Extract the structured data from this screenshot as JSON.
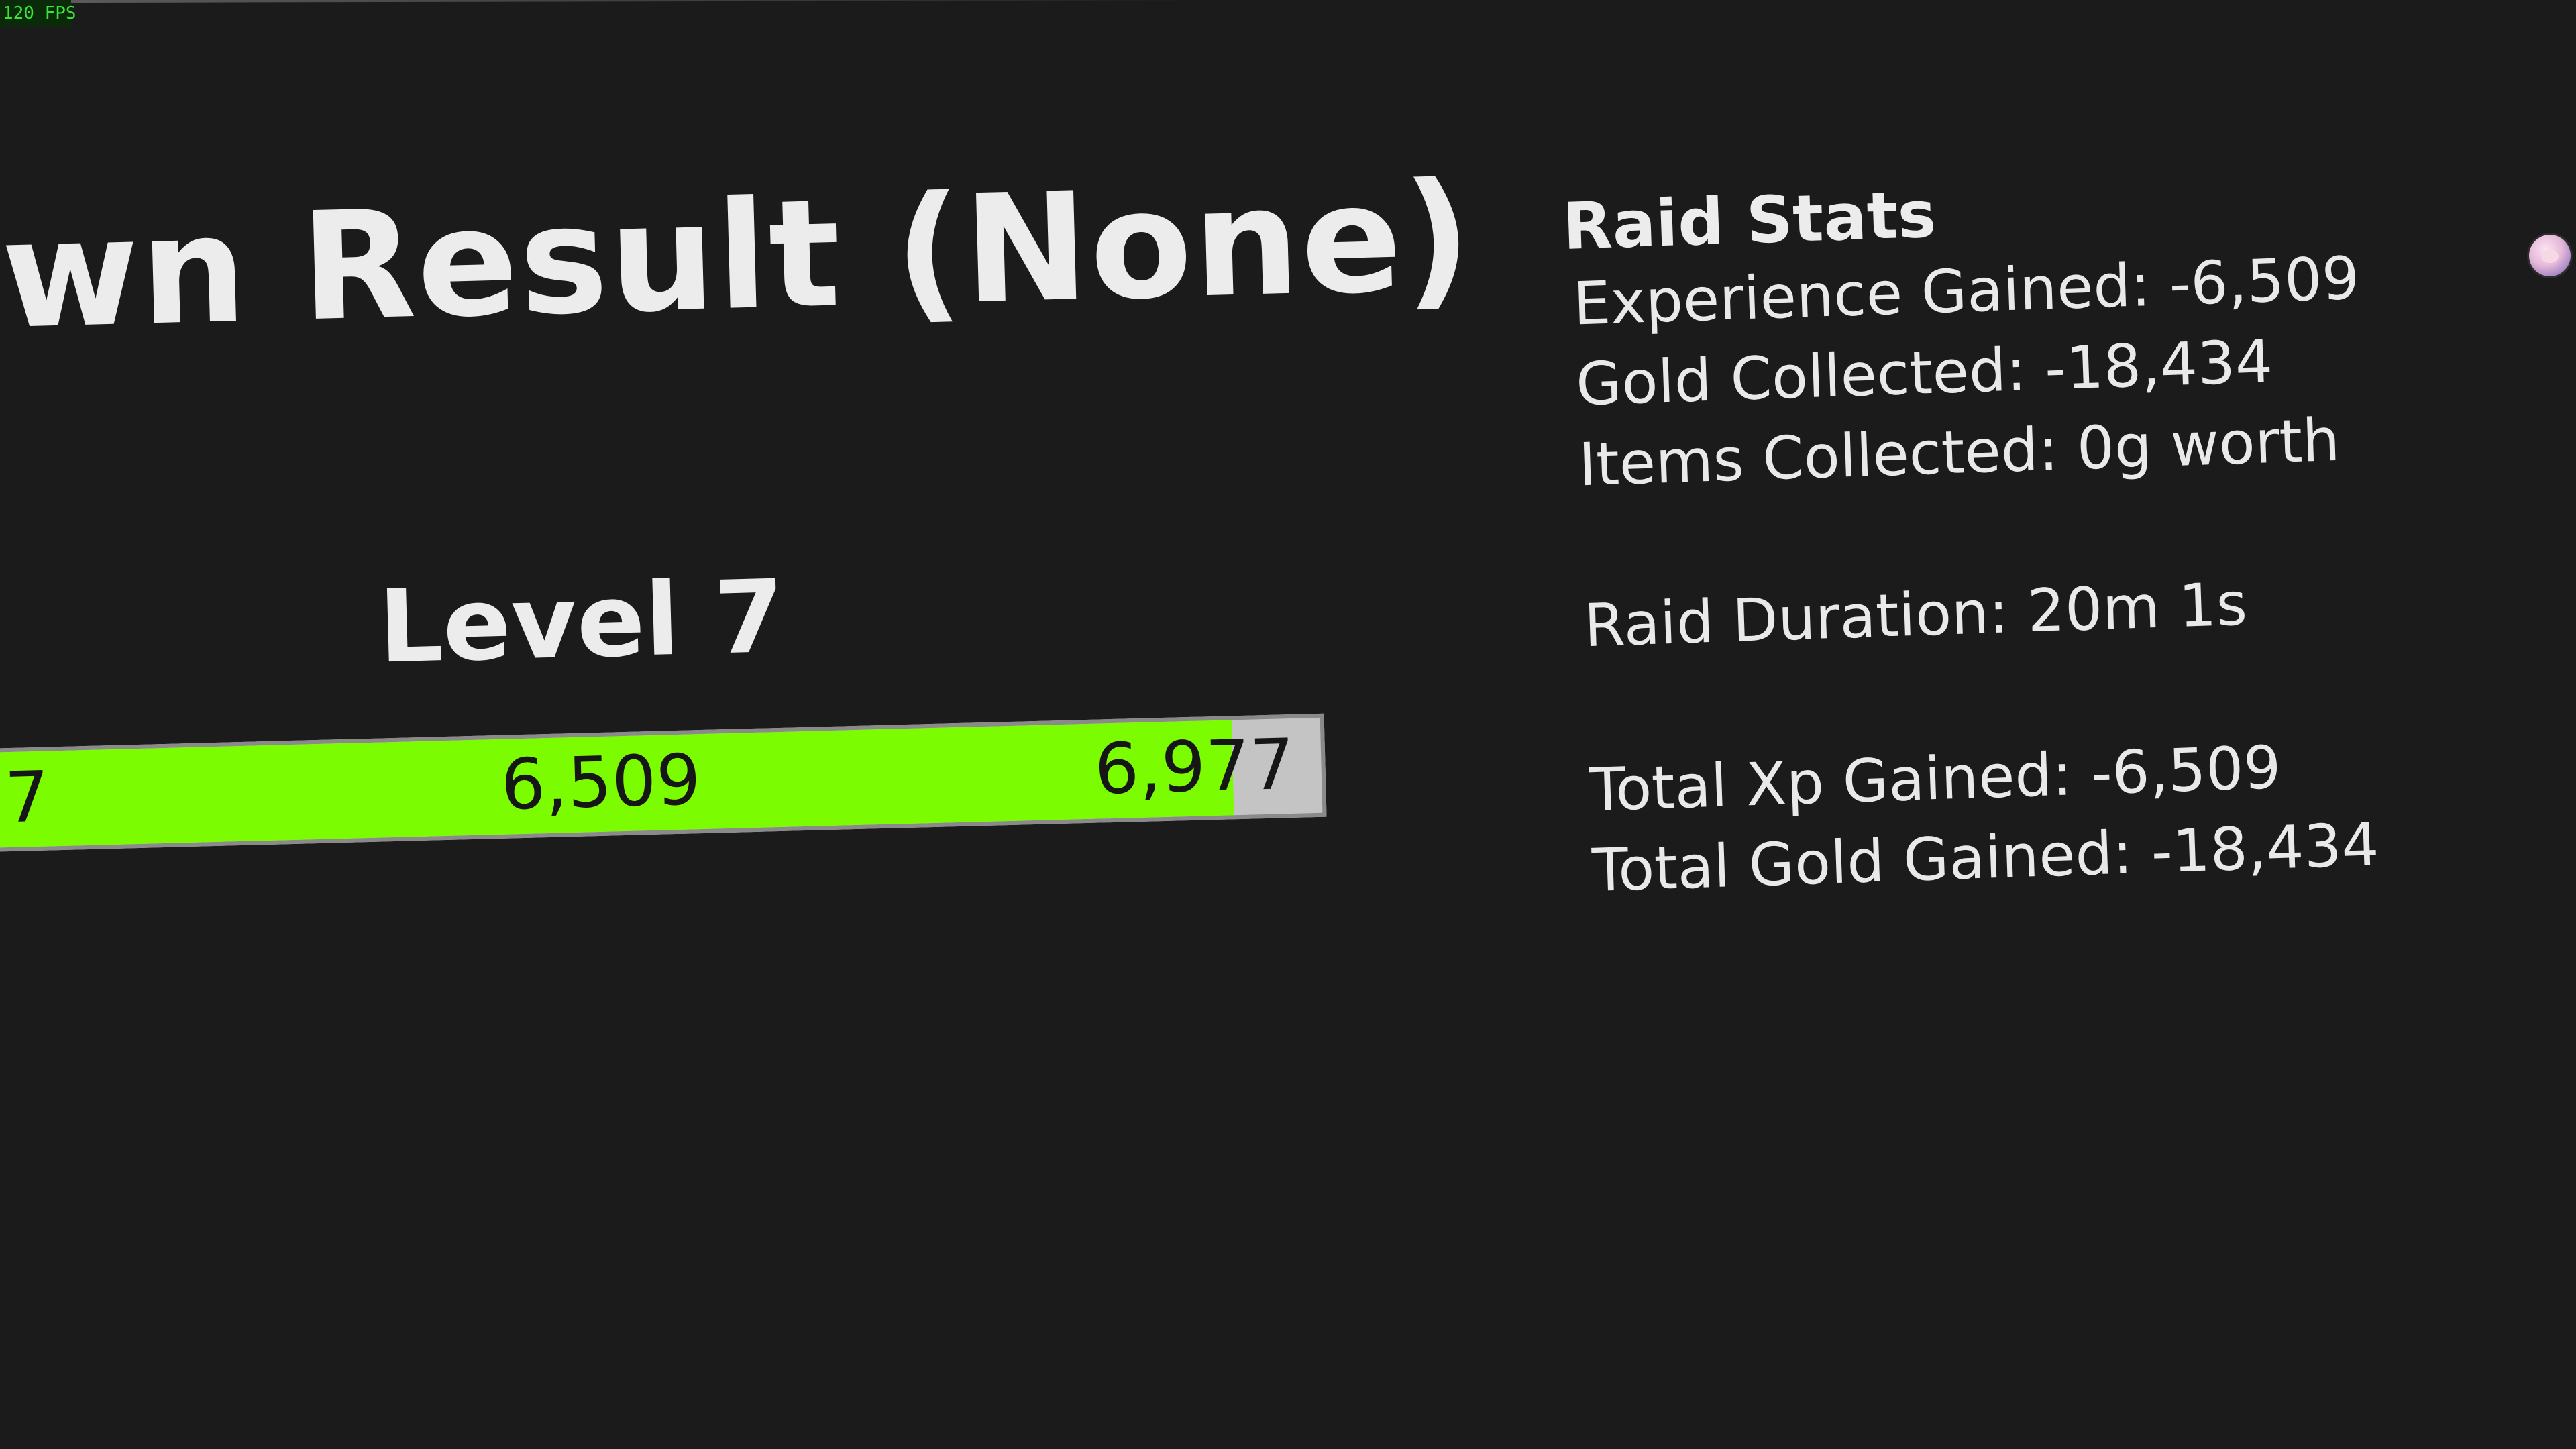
{
  "overlay": {
    "fps": "120 FPS"
  },
  "result": {
    "title": "own Result (None)"
  },
  "level": {
    "label": "Level 7",
    "bar": {
      "min_label": "7",
      "current_label": "6,509",
      "max_label": "6,977",
      "fill_fraction": 0.9329,
      "fill_color": "#7cfc00",
      "empty_color": "#c4c4c4"
    }
  },
  "raid_stats": {
    "title": "Raid Stats",
    "experience_gained": "Experience Gained: -6,509",
    "gold_collected": "Gold Collected: -18,434",
    "items_collected": "Items Collected: 0g worth",
    "raid_duration": "Raid Duration: 20m 1s",
    "total_xp_gained": "Total Xp Gained: -6,509",
    "total_gold_gained": "Total Gold Gained: -18,434"
  },
  "icons": {
    "avatar": "user-avatar-icon"
  },
  "colors": {
    "background": "#1b1b1b",
    "text": "#e7e7e7",
    "fps_text": "#36e336"
  }
}
